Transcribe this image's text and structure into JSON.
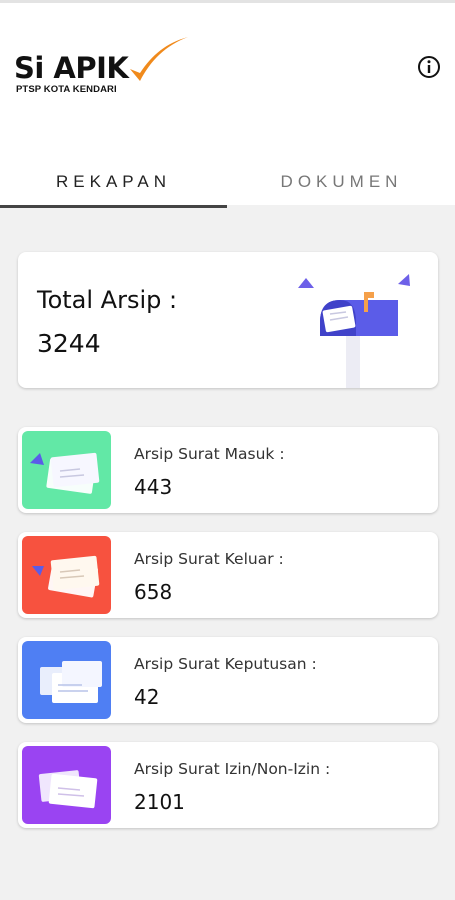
{
  "app": {
    "logo_title": "Si APIK",
    "logo_subtitle": "PTSP KOTA KENDARI",
    "accent_color": "#f08a1c"
  },
  "header": {
    "info_icon": "info-circle-icon"
  },
  "tabs": [
    {
      "label": "REKAPAN",
      "active": true
    },
    {
      "label": "DOKUMEN",
      "active": false
    }
  ],
  "total": {
    "label": "Total Arsip :",
    "value": "3244",
    "icon": "mailbox-illustration"
  },
  "rows": [
    {
      "label": "Arsip Surat Masuk :",
      "value": "443",
      "color": "#62e8a6",
      "icon": "envelopes-illustration"
    },
    {
      "label": "Arsip Surat Keluar :",
      "value": "658",
      "color": "#f7523f",
      "icon": "envelopes-illustration"
    },
    {
      "label": "Arsip Surat Keputusan :",
      "value": "42",
      "color": "#4f7ff3",
      "icon": "envelopes-illustration"
    },
    {
      "label": "Arsip Surat Izin/Non-Izin :",
      "value": "2101",
      "color": "#9a44f2",
      "icon": "envelopes-illustration"
    }
  ]
}
